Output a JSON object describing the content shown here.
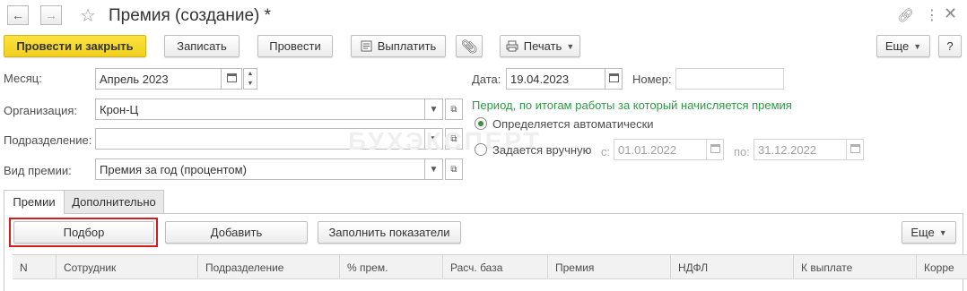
{
  "title": "Премия (создание) *",
  "toolbar": {
    "post_and_close": "Провести и закрыть",
    "save": "Записать",
    "post": "Провести",
    "pay": "Выплатить",
    "print": "Печать",
    "more": "Еще",
    "help": "?"
  },
  "form": {
    "month": {
      "label": "Месяц:",
      "value": "Апрель 2023"
    },
    "organization": {
      "label": "Организация:",
      "value": "Крон-Ц"
    },
    "department": {
      "label": "Подразделение:",
      "value": ""
    },
    "bonus_type": {
      "label": "Вид премии:",
      "value": "Премия за год (процентом)"
    },
    "date": {
      "label": "Дата:",
      "value": "19.04.2023"
    },
    "number": {
      "label": "Номер:",
      "value": ""
    },
    "period_title": "Период, по итогам работы за который начисляется премия",
    "period_auto": "Определяется автоматически",
    "period_manual": "Задается вручную",
    "from_label": "с:",
    "from_value": "01.01.2022",
    "to_label": "по:",
    "to_value": "31.12.2022",
    "period_mode": "auto"
  },
  "watermark": "БУХЭКСПЕРТ",
  "tabs": [
    {
      "label": "Премии",
      "active": true
    },
    {
      "label": "Дополнительно",
      "active": false
    }
  ],
  "table_toolbar": {
    "select": "Подбор",
    "add": "Добавить",
    "fill": "Заполнить показатели",
    "more": "Еще"
  },
  "table": {
    "columns": [
      "N",
      "Сотрудник",
      "Подразделение",
      "% прем.",
      "Расч. база",
      "Премия",
      "НДФЛ",
      "К выплате",
      "Корре"
    ]
  },
  "colors": {
    "primary_button": "#f1cf1f",
    "period_title": "#2b9a45",
    "highlight": "#d21d1d"
  },
  "icons": [
    "back-arrow-icon",
    "forward-arrow-icon",
    "favorite-star-icon",
    "link-icon",
    "more-vert-icon",
    "close-icon",
    "pay-icon",
    "attachment-icon",
    "printer-icon",
    "calendar-icon",
    "open-form-icon",
    "dropdown-icon"
  ]
}
